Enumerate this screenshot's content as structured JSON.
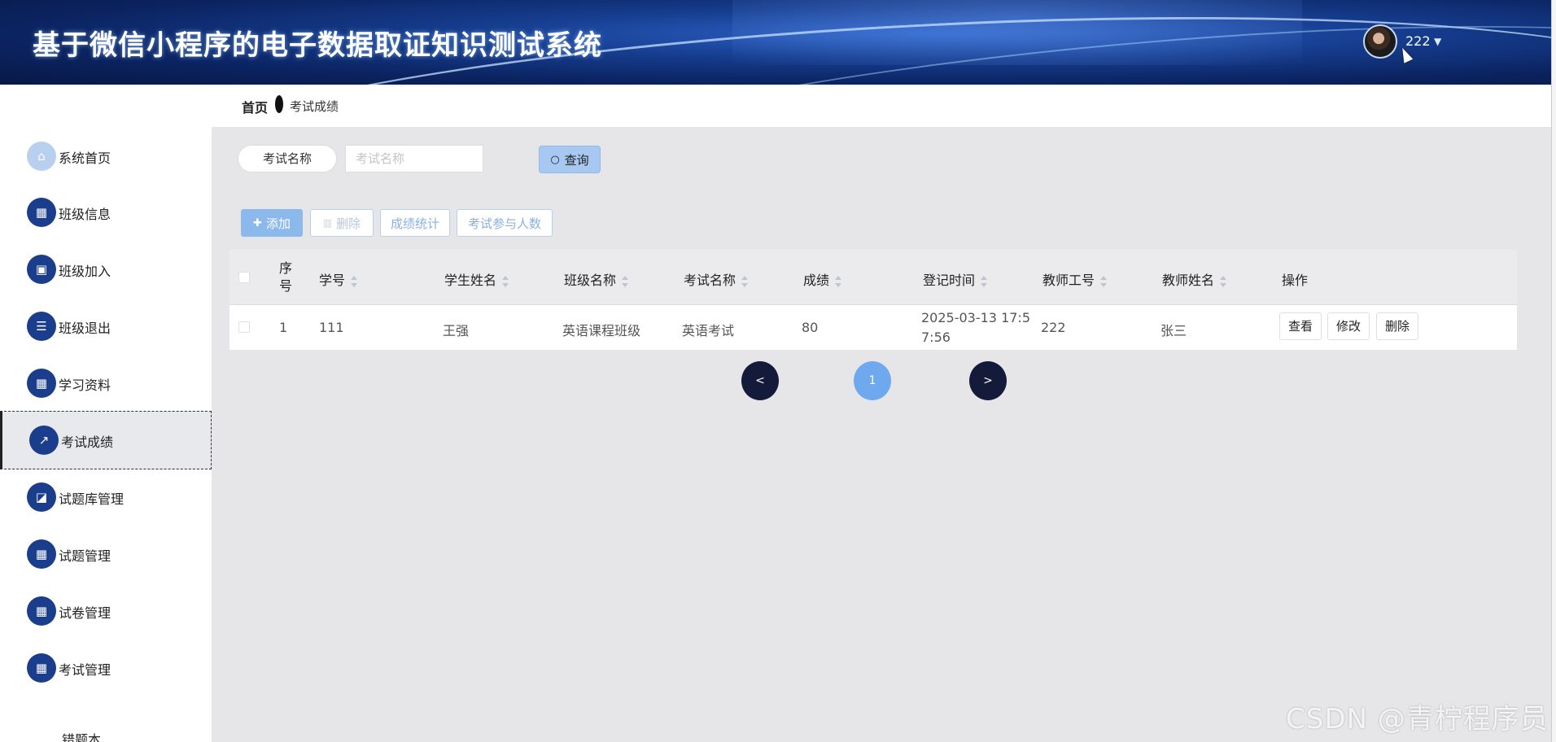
{
  "header": {
    "title": "基于微信小程序的电子数据取证知识测试系统",
    "user_name": "222",
    "caret": "▼"
  },
  "sidebar": {
    "items": [
      {
        "label": "系统首页",
        "icon": "home-icon",
        "glyph": "⌂"
      },
      {
        "label": "班级信息",
        "icon": "grid-icon",
        "glyph": "▦"
      },
      {
        "label": "班级加入",
        "icon": "briefcase-icon",
        "glyph": "▣"
      },
      {
        "label": "班级退出",
        "icon": "sliders-icon",
        "glyph": "☰"
      },
      {
        "label": "学习资料",
        "icon": "grid-icon",
        "glyph": "▦"
      },
      {
        "label": "考试成绩",
        "icon": "chart-icon",
        "glyph": "↗"
      },
      {
        "label": "试题库管理",
        "icon": "bank-icon",
        "glyph": "◪"
      },
      {
        "label": "试题管理",
        "icon": "grid-icon",
        "glyph": "▦"
      },
      {
        "label": "试卷管理",
        "icon": "grid-icon",
        "glyph": "▦"
      },
      {
        "label": "考试管理",
        "icon": "grid-icon",
        "glyph": "▦"
      },
      {
        "label": "错题本",
        "icon": "",
        "glyph": ""
      }
    ]
  },
  "breadcrumb": {
    "home": "首页",
    "current": "考试成绩"
  },
  "search": {
    "label": "考试名称",
    "placeholder": "考试名称",
    "value": "",
    "button_label": "查询",
    "button_icon": "○"
  },
  "actions": {
    "add": "添加",
    "add_icon": "✚",
    "delete": "删除",
    "delete_icon": "🗑",
    "stats": "成绩统计",
    "participants": "考试参与人数"
  },
  "table": {
    "headers": {
      "index": "序号",
      "student_no": "学号",
      "student_name": "学生姓名",
      "class_name": "班级名称",
      "exam_name": "考试名称",
      "score": "成绩",
      "register_time": "登记时间",
      "teacher_no": "教师工号",
      "teacher_name": "教师姓名",
      "operation": "操作"
    },
    "rows": [
      {
        "index": "1",
        "student_no": "111",
        "student_name": "王强",
        "class_name": "英语课程班级",
        "exam_name": "英语考试",
        "score": "80",
        "register_time": "2025-03-13 17:57:56",
        "teacher_no": "222",
        "teacher_name": "张三",
        "ops": {
          "view": "查看",
          "edit": "修改",
          "delete": "删除"
        }
      }
    ]
  },
  "pagination": {
    "prev": "<",
    "current": "1",
    "next": ">"
  },
  "watermark": "CSDN @青柠程序员"
}
